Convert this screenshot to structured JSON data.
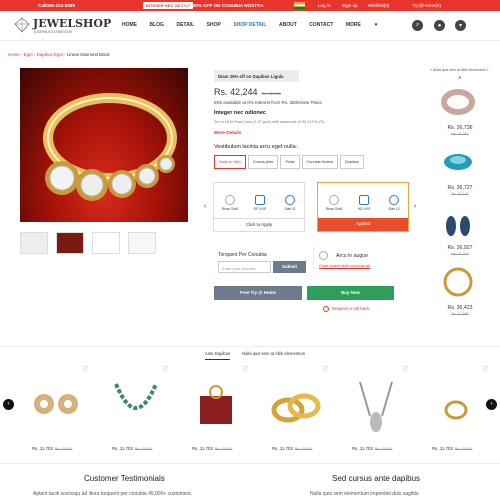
{
  "topbar": {
    "phone": "Call080-222-8289",
    "pill": "INTEGER NEC ODIONE",
    "promo": "FLAT 30% OFF ON CONUBIA NOSTRA",
    "links": [
      "Log in",
      "Sign up",
      "Wishlist(0)",
      "Try@Home(0)"
    ]
  },
  "header": {
    "logo": "JEWELSHOP",
    "logo_sub": "A DAPIBUS ELEMENTUM",
    "nav": [
      "HOME",
      "BLOG",
      "DETAIL",
      "SHOP",
      "SHOP DETAIL",
      "ABOUT",
      "CONTACT",
      "MORE"
    ],
    "active_index": 4
  },
  "breadcrumb": {
    "items": [
      "Home",
      "Eget",
      "Dapibus Eget",
      "Linear Diamond Band"
    ]
  },
  "product": {
    "offer": "Diam 25% off on Dapibus Ligula",
    "price": "Rs. 42,244",
    "old_price": "Rs. 32,900",
    "emi": "EMI available at 0% Interest from Rs. 3500View Plans",
    "title": "Integer nec odionec",
    "desc": "Set in 18 kt Rose Gold (2.97 gms) with diamonds (0.99 Ct,F6-VS)",
    "more": "More Details",
    "variant_label": "Vestibulum lacinia arcu eget nulla:",
    "variants": [
      "Nulla to Nibh",
      "Cursus Ante",
      "Porta",
      "Conubia Nostra",
      "Dapibus"
    ],
    "selected_variant": 0,
    "cards": [
      {
        "specs": [
          {
            "code": "14KT",
            "label": "Rose Gold"
          },
          {
            "code": "diamond",
            "label": "EF-VVS"
          },
          {
            "code": "ring",
            "label": "Size 11"
          }
        ],
        "button": "Click to Apply",
        "active": false
      },
      {
        "specs": [
          {
            "code": "18KT",
            "label": "Rose Gold"
          },
          {
            "code": "diamond",
            "label": "HD-VVS"
          },
          {
            "code": "ring",
            "label": "Size 12"
          }
        ],
        "button": "Applied",
        "active": true
      }
    ],
    "pincode_label": "Torquent Per Conubia",
    "pincode_placeholder": "Enter your pincode",
    "submit": "Submit",
    "arcu_title": "Arcu in augue",
    "arcu_link": "Class aptent taciti sociosqu ad",
    "try_btn": "Free Try @ Home",
    "buy_btn": "Buy Now",
    "callback": "Request a call back"
  },
  "sidebar": {
    "heading": "« Nulla quis sem at nibh elementum »",
    "items": [
      {
        "price": "Rs. 36,736",
        "old": "Rs. 37,900"
      },
      {
        "price": "Rs. 36,727",
        "old": "Rs. 37,127"
      },
      {
        "price": "Rs. 36,927",
        "old": "Rs. 37,330"
      },
      {
        "price": "Rs. 36,423",
        "old": "Rs. 37,889"
      }
    ]
  },
  "tabs": {
    "items": [
      "Ante Dapibus",
      "Nulla quis sem at nibh elementum"
    ],
    "active": 0
  },
  "products": [
    {
      "price": "Rs. 11,703",
      "old": "Rs. 12,000"
    },
    {
      "price": "Rs. 11,703",
      "old": "Rs. 12,000"
    },
    {
      "price": "Rs. 11,703",
      "old": "Rs. 12,000"
    },
    {
      "price": "Rs. 11,703",
      "old": "Rs. 12,000"
    },
    {
      "price": "Rs. 11,703",
      "old": "Rs. 12,000"
    },
    {
      "price": "Rs. 11,703",
      "old": "Rs. 12,000"
    }
  ],
  "sections": {
    "left_title": "Customer Testimonials",
    "left_sub": "Aptent taciti sociosqu ad litora torquent per conubia 45,000+ customers.",
    "right_title": "Sed cursus ante dapibus",
    "right_sub": "Nulla quis sem elementum imperdiet duis sagittis."
  },
  "colors": {
    "accent": "#e8342b",
    "link": "#2a7bd6",
    "buy": "#2f9e5b",
    "try": "#6e7b8e"
  }
}
